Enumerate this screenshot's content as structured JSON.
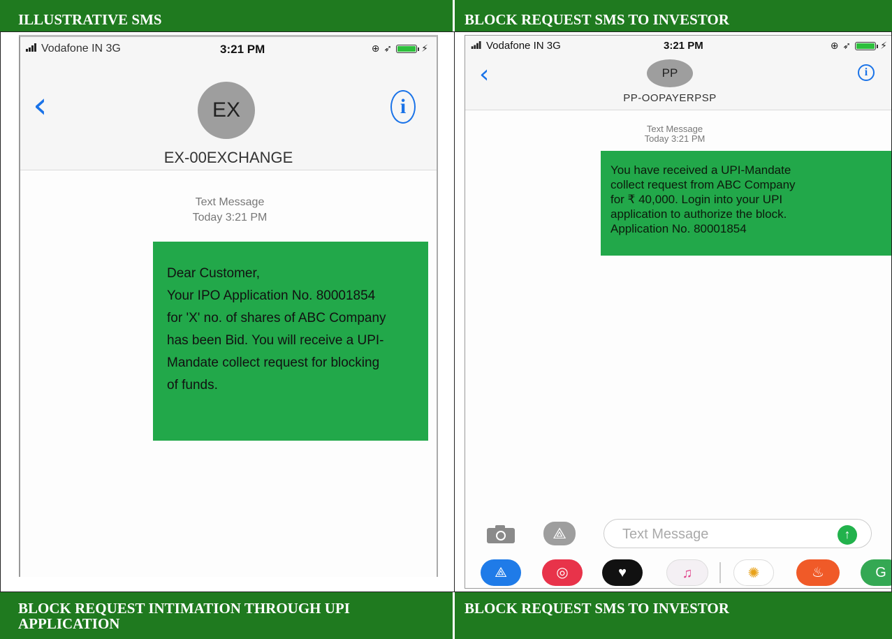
{
  "headers": {
    "top_left": "ILLUSTRATIVE SMS",
    "top_right": "BLOCK REQUEST SMS TO INVESTOR",
    "bottom_left_line1": "BLOCK REQUEST INTIMATION THROUGH UPI",
    "bottom_left_line2": "APPLICATION",
    "bottom_right": "BLOCK REQUEST SMS TO INVESTOR"
  },
  "left_phone": {
    "carrier": "Vodafone IN  3G",
    "time": "3:21 PM",
    "avatar_initials": "EX",
    "sender": "EX-00EXCHANGE",
    "meta_line1": "Text Message",
    "meta_line2": "Today 3:21 PM",
    "message_lines": [
      "Dear Customer,",
      "Your IPO Application No. 80001854",
      "for 'X' no. of shares of ABC Company",
      "has been Bid. You will receive a UPI-",
      "Mandate collect request for blocking",
      "of funds."
    ],
    "icons": {
      "back": "chevron-left-icon",
      "info": "info-icon",
      "battery": "battery-icon"
    }
  },
  "right_phone": {
    "carrier": "Vodafone IN  3G",
    "time": "3:21 PM",
    "avatar_initials": "PP",
    "sender": "PP-OOPAYERPSP",
    "meta_line1": "Text Message",
    "meta_line2": "Today 3:21 PM",
    "message_lines": [
      "You have received a UPI-Mandate",
      "collect request from ABC Company",
      "for ₹ 40,000. Login into your UPI",
      "application to authorize the block.",
      "Application No. 80001854"
    ],
    "compose_placeholder": "Text Message",
    "dock_icons": [
      "app-store-icon",
      "search-globe-icon",
      "heart-icon",
      "music-icon",
      "photos-icon",
      "game-icon",
      "maps-icon"
    ]
  },
  "colors": {
    "header_green": "#1f7a1f",
    "bubble_green": "#22a84a",
    "ios_blue": "#1a73e8"
  }
}
